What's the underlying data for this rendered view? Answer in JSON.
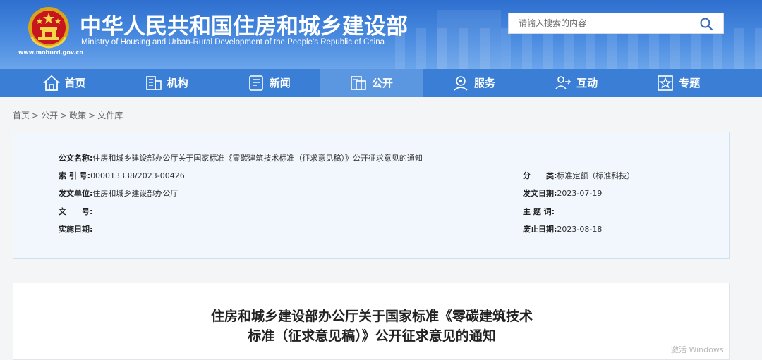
{
  "header": {
    "title_cn": "中华人民共和国住房和城乡建设部",
    "title_en": "Ministry of Housing and Urban-Rural Development of the People’s Republic of China",
    "site_url": "www.mohurd.gov.cn",
    "emblem_icon": "national-emblem-icon"
  },
  "search": {
    "placeholder": "请输入搜索的内容",
    "icon": "search-icon"
  },
  "nav": {
    "items": [
      {
        "label": "首页",
        "icon": "home-icon"
      },
      {
        "label": "机构",
        "icon": "building-icon"
      },
      {
        "label": "新闻",
        "icon": "news-icon"
      },
      {
        "label": "公开",
        "icon": "public-icon"
      },
      {
        "label": "服务",
        "icon": "service-icon"
      },
      {
        "label": "互动",
        "icon": "interact-icon"
      },
      {
        "label": "专题",
        "icon": "star-icon"
      }
    ],
    "active": "公开"
  },
  "breadcrumb": {
    "items": [
      "首页",
      "公开",
      "政策",
      "文件库"
    ],
    "separator": ">"
  },
  "meta": {
    "title_label": "公文名称:",
    "title_value": "住房和城乡建设部办公厅关于国家标准《零碳建筑技术标准（征求意见稿）》公开征求意见的通知",
    "index_label": "索 引 号:",
    "index_value": "000013338/2023-00426",
    "category_label": "分　　类:",
    "category_value": "标准定额（标准科技）",
    "issuer_label": "发文单位:",
    "issuer_value": "住房和城乡建设部办公厅",
    "issue_date_label": "发文日期:",
    "issue_date_value": "2023-07-19",
    "doc_no_label": "文　　号:",
    "doc_no_value": "",
    "subject_label": "主 题 词:",
    "subject_value": "",
    "effective_label": "实施日期:",
    "effective_value": "",
    "expiry_label": "废止日期:",
    "expiry_value": "2023-08-18"
  },
  "document": {
    "title_line1": "住房和城乡建设部办公厅关于国家标准《零碳建筑技术",
    "title_line2": "标准（征求意见稿）》公开征求意见的通知"
  },
  "watermark": "激活 Windows",
  "colors": {
    "header_blue": "#2e6fcf",
    "nav_blue": "#3a7fd5",
    "nav_active": "#5b96e0",
    "meta_bg": "#f1f7fd"
  }
}
